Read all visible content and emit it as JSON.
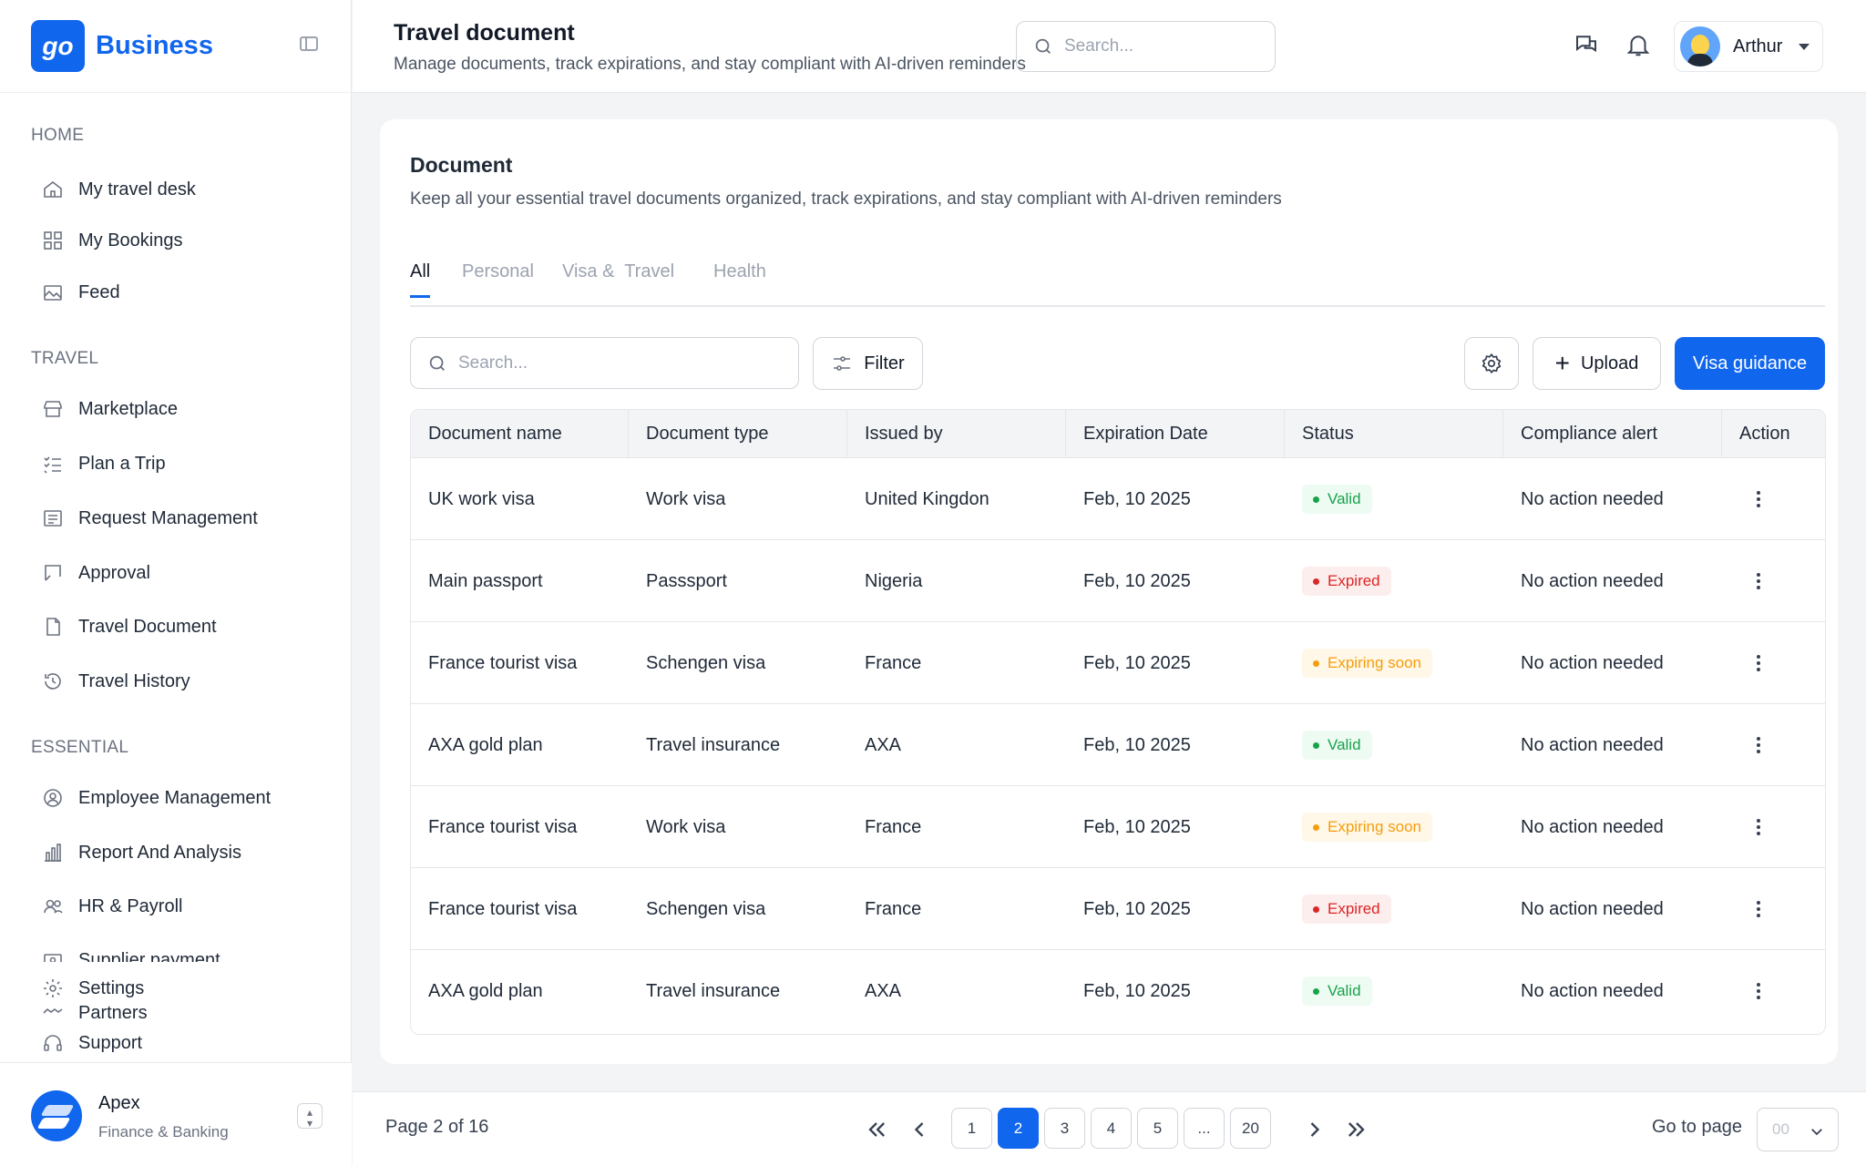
{
  "brand": {
    "logo_text": "go",
    "name": "Business"
  },
  "sidebar": {
    "sections": [
      {
        "title": "HOME",
        "items": [
          {
            "label": "My travel desk",
            "icon": "home-icon"
          },
          {
            "label": "My Bookings",
            "icon": "grid-icon"
          },
          {
            "label": "Feed",
            "icon": "image-icon"
          }
        ]
      },
      {
        "title": "TRAVEL",
        "items": [
          {
            "label": "Marketplace",
            "icon": "store-icon"
          },
          {
            "label": "Plan a Trip",
            "icon": "checklist-icon"
          },
          {
            "label": "Request Management",
            "icon": "message-square-icon"
          },
          {
            "label": "Approval",
            "icon": "approval-icon"
          },
          {
            "label": "Travel Document",
            "icon": "file-icon"
          },
          {
            "label": "Travel History",
            "icon": "history-icon"
          }
        ]
      },
      {
        "title": "ESSENTIAL",
        "items": [
          {
            "label": "Employee Management",
            "icon": "user-circle-icon"
          },
          {
            "label": "Report And Analysis",
            "icon": "bar-chart-icon"
          },
          {
            "label": "HR & Payroll",
            "icon": "users-icon"
          },
          {
            "label": "Supplier payment",
            "icon": "cash-icon"
          },
          {
            "label": "Settings",
            "icon": "gear-icon"
          },
          {
            "label": "Partners",
            "icon": "handshake-icon"
          },
          {
            "label": "Support",
            "icon": "headset-icon"
          }
        ]
      }
    ],
    "org": {
      "name": "Apex",
      "subtitle": "Finance & Banking"
    }
  },
  "header": {
    "title": "Travel document",
    "subtitle": "Manage documents, track expirations, and stay compliant with AI-driven reminders",
    "search_placeholder": "Search...",
    "user_name": "Arthur"
  },
  "document": {
    "title": "Document",
    "subtitle": "Keep all your essential travel documents organized, track expirations, and stay compliant with AI-driven reminders",
    "tabs": [
      "All",
      "Personal",
      "Visa &  Travel",
      "Health"
    ],
    "active_tab": "All",
    "search_placeholder": "Search...",
    "filter_label": "Filter",
    "upload_label": "Upload",
    "visa_label": "Visa guidance"
  },
  "table": {
    "columns": [
      "Document name",
      "Document type",
      "Issued by",
      "Expiration Date",
      "Status",
      "Compliance alert",
      "Action"
    ],
    "rows": [
      {
        "name": "UK work visa",
        "type": "Work visa",
        "issuer": "United Kingdon",
        "expiry": "Feb, 10 2025",
        "status": "Valid",
        "status_kind": "valid",
        "alert": "No action needed"
      },
      {
        "name": "Main passport",
        "type": "Passsport",
        "issuer": "Nigeria",
        "expiry": "Feb, 10 2025",
        "status": "Expired",
        "status_kind": "expired",
        "alert": "No action needed"
      },
      {
        "name": "France tourist visa",
        "type": "Schengen visa",
        "issuer": "France",
        "expiry": "Feb, 10 2025",
        "status": "Expiring soon",
        "status_kind": "expiring",
        "alert": "No action needed"
      },
      {
        "name": "AXA gold plan",
        "type": "Travel insurance",
        "issuer": "AXA",
        "expiry": "Feb, 10 2025",
        "status": "Valid",
        "status_kind": "valid",
        "alert": "No action needed"
      },
      {
        "name": "France tourist visa",
        "type": "Work visa",
        "issuer": "France",
        "expiry": "Feb, 10 2025",
        "status": "Expiring soon",
        "status_kind": "expiring",
        "alert": "No action needed"
      },
      {
        "name": "France tourist visa",
        "type": "Schengen visa",
        "issuer": "France",
        "expiry": "Feb, 10 2025",
        "status": "Expired",
        "status_kind": "expired",
        "alert": "No action needed"
      },
      {
        "name": "AXA gold plan",
        "type": "Travel insurance",
        "issuer": "AXA",
        "expiry": "Feb, 10 2025",
        "status": "Valid",
        "status_kind": "valid",
        "alert": "No action needed"
      }
    ]
  },
  "pagination": {
    "info": "Page 2 of 16",
    "pages": [
      "1",
      "2",
      "3",
      "4",
      "5",
      "...",
      "20"
    ],
    "current": "2",
    "goto_label": "Go to page",
    "goto_value": "00"
  },
  "colors": {
    "accent": "#1166ee",
    "valid": "#16a34a",
    "expired": "#dc2626",
    "expiring": "#f59e0b"
  }
}
